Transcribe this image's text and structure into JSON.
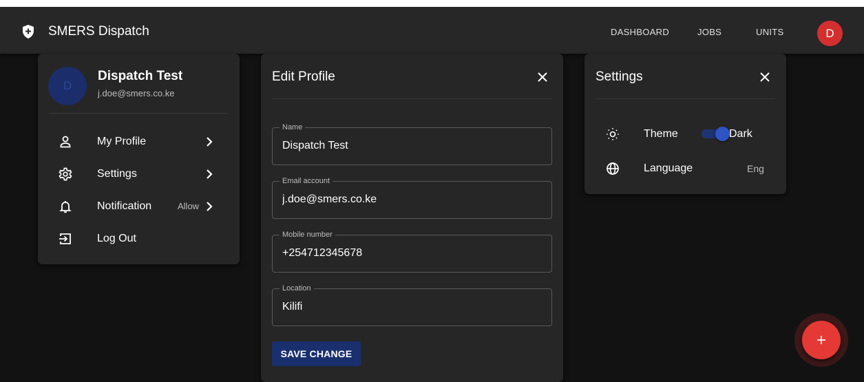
{
  "app": {
    "title": "SMERS Dispatch",
    "nav": [
      "DASHBOARD",
      "JOBS",
      "UNITS"
    ],
    "user_initial": "D",
    "accent_color": "#d32f2f"
  },
  "profile_menu": {
    "avatar_initial": "D",
    "name": "Dispatch Test",
    "email": "j.doe@smers.co.ke",
    "items": [
      {
        "label": "My Profile",
        "icon": "person-icon"
      },
      {
        "label": "Settings",
        "icon": "gear-icon"
      },
      {
        "label": "Notification",
        "icon": "bell-icon",
        "extra": "Allow"
      },
      {
        "label": "Log Out",
        "icon": "logout-icon"
      }
    ]
  },
  "edit_profile": {
    "title": "Edit Profile",
    "fields": [
      {
        "label": "Name",
        "value": "Dispatch Test"
      },
      {
        "label": "Email account",
        "value": "j.doe@smers.co.ke"
      },
      {
        "label": "Mobile number",
        "value": "+254712345678"
      },
      {
        "label": "Location",
        "value": "Kilifi"
      }
    ],
    "save_label": "SAVE CHANGE"
  },
  "settings": {
    "title": "Settings",
    "theme_label": "Theme",
    "theme_value": "Dark",
    "language_label": "Language",
    "language_value": "Eng"
  },
  "fab": {
    "icon": "plus-icon",
    "label": "+"
  }
}
